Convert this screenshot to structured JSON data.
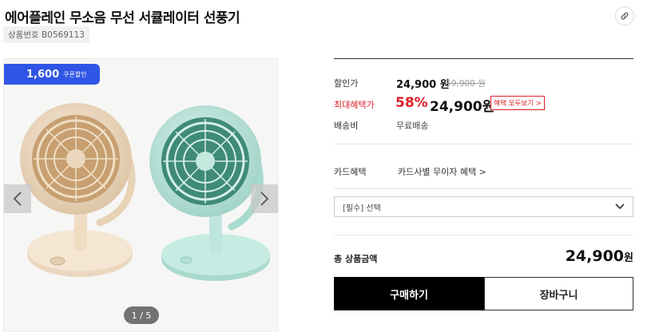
{
  "product": {
    "title": "에어플레인 무소음 무선 서큘레이터 선풍기",
    "code": "상품번호 B0569113"
  },
  "share": {
    "icon": "link-icon"
  },
  "gallery": {
    "coupon_amount": "1,600",
    "coupon_label": "쿠폰할인",
    "pager": "1 / 5",
    "prev_icon": "chevron-left-icon",
    "next_icon": "chevron-right-icon",
    "colors": {
      "left_fan": "#efdcc2",
      "right_fan": "#bfe6dc"
    }
  },
  "pricing": {
    "sale_label": "할인가",
    "sale_price": "24,900 원",
    "original_price": "59,900 원",
    "max_label": "최대혜택가",
    "max_percent": "58%",
    "max_price": "24,900원",
    "benefit_button": "혜택 모두보기 >",
    "shipping_label": "배송비",
    "shipping_value": "무료배송"
  },
  "card": {
    "label": "카드혜택",
    "link": "카드사별 무이자 혜택 >"
  },
  "option": {
    "select_text": "[필수] 선택",
    "icon": "chevron-down-icon"
  },
  "total": {
    "label": "총 상품금액",
    "amount": "24,900",
    "unit": "원"
  },
  "actions": {
    "buy": "구매하기",
    "cart": "장바구니"
  },
  "colors": {
    "accent_red": "#e0202a",
    "coupon_blue": "#2f55e6",
    "buy_black": "#000000"
  }
}
